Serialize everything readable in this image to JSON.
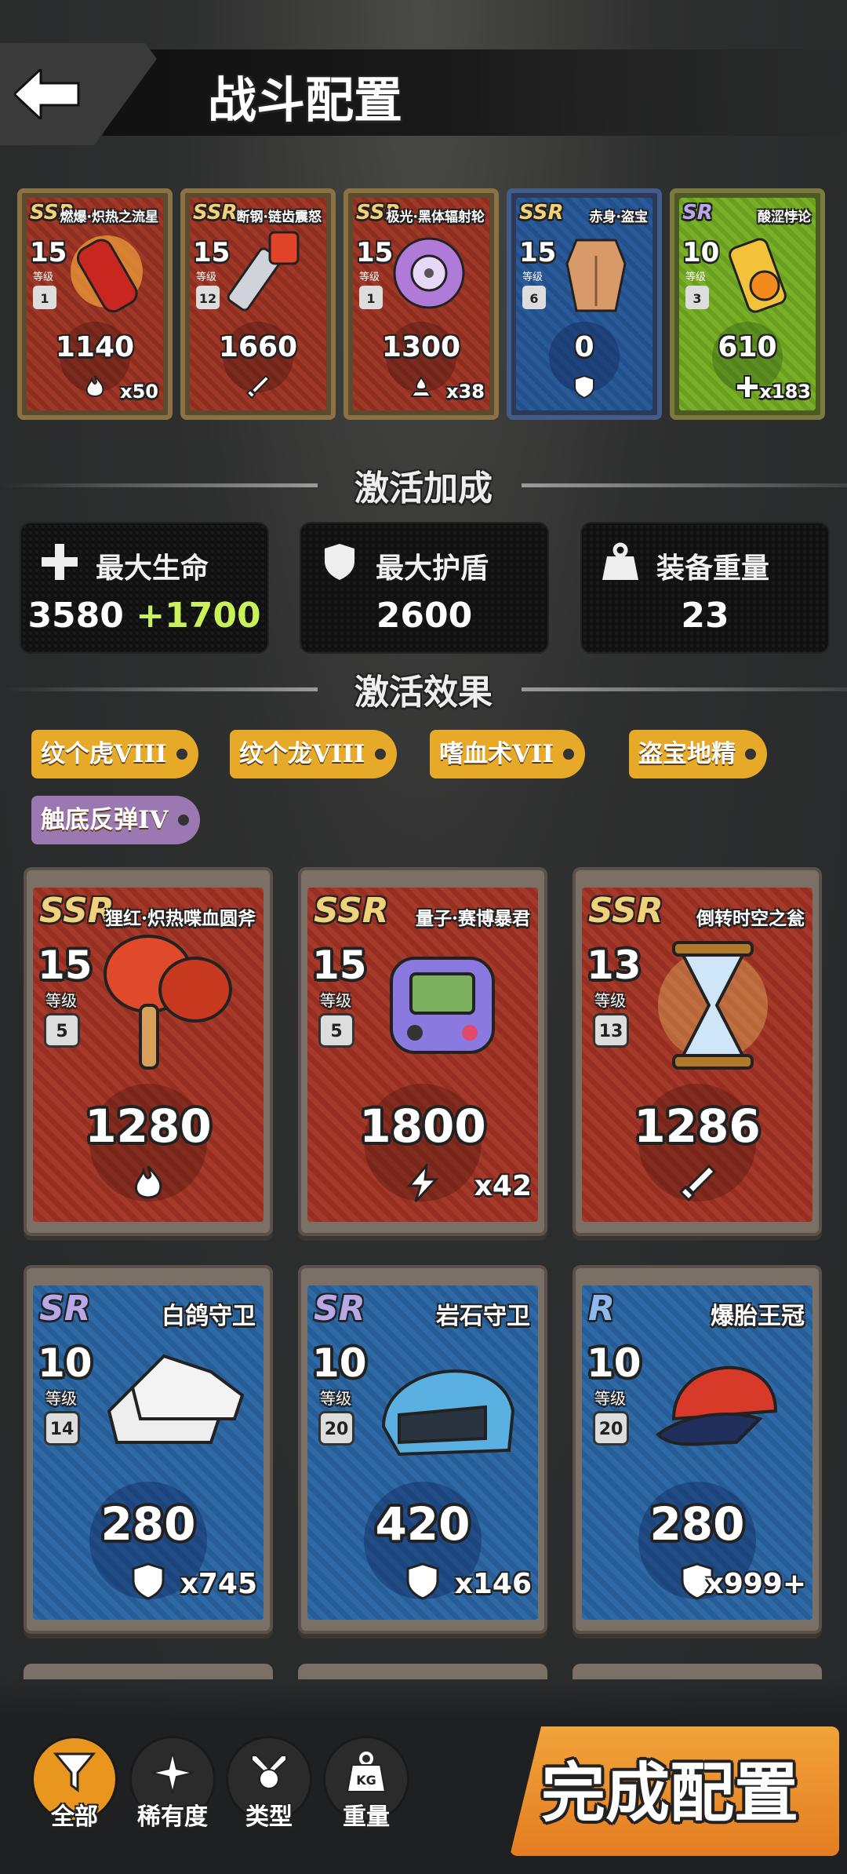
{
  "header": {
    "title": "战斗配置"
  },
  "equipped": [
    {
      "rarity": "SSR",
      "name": "燃爆·炽热之流星",
      "level": "15",
      "level_label": "等级",
      "weight": "1",
      "value": "1140",
      "type": "fire",
      "count": "x50",
      "color": "red"
    },
    {
      "rarity": "SSR",
      "name": "断钢·链齿震怒",
      "level": "15",
      "level_label": "等级",
      "weight": "12",
      "value": "1660",
      "type": "sword",
      "count": "",
      "color": "red"
    },
    {
      "rarity": "SSR",
      "name": "极光·黑体辐射轮",
      "level": "15",
      "level_label": "等级",
      "weight": "1",
      "value": "1300",
      "type": "acid",
      "count": "x38",
      "color": "red"
    },
    {
      "rarity": "SSR",
      "name": "赤身·盗宝",
      "level": "15",
      "level_label": "等级",
      "weight": "6",
      "value": "0",
      "type": "shield",
      "count": "",
      "color": "blue"
    },
    {
      "rarity": "SR",
      "name": "酸涩悖论",
      "level": "10",
      "level_label": "等级",
      "weight": "3",
      "value": "610",
      "type": "heal",
      "count": "x183",
      "color": "green"
    }
  ],
  "bonus_section": {
    "title": "激活加成"
  },
  "stats": [
    {
      "icon": "plus-icon",
      "label": "最大生命",
      "value": "3580",
      "bonus": "+1700"
    },
    {
      "icon": "shield-icon",
      "label": "最大护盾",
      "value": "2600",
      "bonus": ""
    },
    {
      "icon": "weight-icon",
      "label": "装备重量",
      "value": "23",
      "bonus": ""
    }
  ],
  "effects_section": {
    "title": "激活效果"
  },
  "tags": [
    {
      "label": "纹个虎VIII",
      "color": "gold"
    },
    {
      "label": "纹个龙VIII",
      "color": "gold"
    },
    {
      "label": "嗜血术VII",
      "color": "gold"
    },
    {
      "label": "盗宝地精",
      "color": "gold"
    },
    {
      "label": "触底反弹IV",
      "color": "purple"
    }
  ],
  "inventory": [
    {
      "rarity": "SSR",
      "name": "狸红·炽热喋血圆斧",
      "level": "15",
      "level_label": "等级",
      "weight": "5",
      "value": "1280",
      "type": "fire",
      "count": "",
      "color": "red"
    },
    {
      "rarity": "SSR",
      "name": "量子·赛博暴君",
      "level": "15",
      "level_label": "等级",
      "weight": "5",
      "value": "1800",
      "type": "lightning",
      "count": "x42",
      "color": "red"
    },
    {
      "rarity": "SSR",
      "name": "倒转时空之瓮",
      "level": "13",
      "level_label": "等级",
      "weight": "13",
      "value": "1286",
      "type": "sword",
      "count": "",
      "color": "red"
    },
    {
      "rarity": "SR",
      "name": "白鸽守卫",
      "level": "10",
      "level_label": "等级",
      "weight": "14",
      "value": "280",
      "type": "shield",
      "count": "x745",
      "color": "blue"
    },
    {
      "rarity": "SR",
      "name": "岩石守卫",
      "level": "10",
      "level_label": "等级",
      "weight": "20",
      "value": "420",
      "type": "shield",
      "count": "x146",
      "color": "blue"
    },
    {
      "rarity": "R",
      "name": "爆胎王冠",
      "level": "10",
      "level_label": "等级",
      "weight": "20",
      "value": "280",
      "type": "shield",
      "count": "x999+",
      "color": "blue"
    }
  ],
  "filters": [
    {
      "label": "全部",
      "icon": "filter-icon",
      "active": true
    },
    {
      "label": "稀有度",
      "icon": "sparkle-icon",
      "active": false
    },
    {
      "label": "类型",
      "icon": "crossed-swords-icon",
      "active": false
    },
    {
      "label": "重量",
      "icon": "kg-weight-icon",
      "active": false
    }
  ],
  "filter_kg_text": "KG",
  "done_button": {
    "label": "完成配置"
  },
  "colors": {
    "accent": "#e8961e",
    "bonus_green": "#c9f25a",
    "tag_gold": "#e6a928",
    "tag_purple": "#9c78b2"
  }
}
